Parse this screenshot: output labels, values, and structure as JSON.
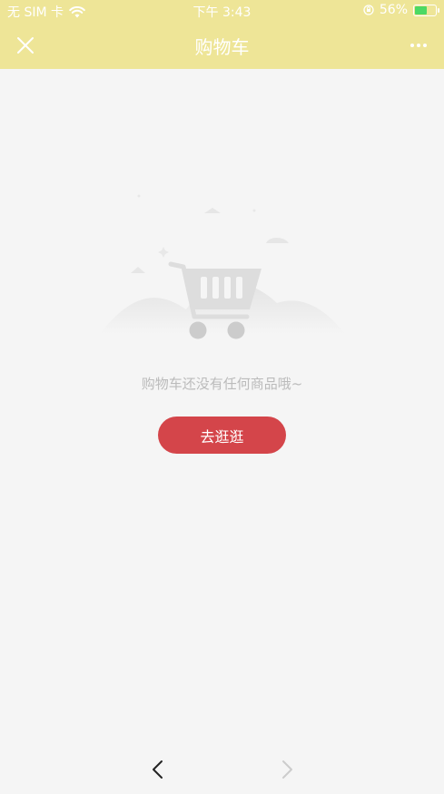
{
  "status_bar": {
    "carrier": "无 SIM 卡",
    "time": "下午 3:43",
    "battery_percent": "56%",
    "battery_level": 0.56,
    "wifi_icon": "wifi-icon",
    "lock_icon": "orientation-lock-icon"
  },
  "header": {
    "title": "购物车",
    "background_color": "#eee597",
    "close_icon": "close-icon",
    "more_icon": "more-icon"
  },
  "empty_state": {
    "illustration_icon": "shopping-cart-icon",
    "message": "购物车还没有任何商品哦~",
    "button_label": "去逛逛",
    "button_color": "#d4454a"
  },
  "bottom_nav": {
    "back_icon": "chevron-left-icon",
    "forward_icon": "chevron-right-icon"
  }
}
